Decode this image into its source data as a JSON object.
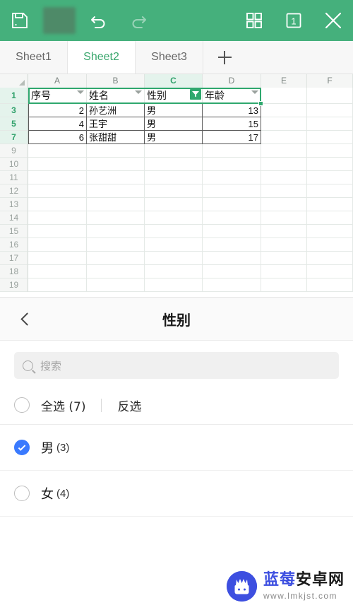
{
  "toolbar": {
    "save_label": "save-icon",
    "redacted_label": "",
    "undo_label": "undo-icon",
    "redo_label": "redo-icon",
    "grid_label": "grid-icon",
    "sheet_count_label": "1",
    "close_label": "close-icon",
    "bg_color": "#45b07c"
  },
  "sheets": {
    "tabs": [
      {
        "label": "Sheet1",
        "active": false
      },
      {
        "label": "Sheet2",
        "active": true
      },
      {
        "label": "Sheet3",
        "active": false
      }
    ],
    "add_label": "+"
  },
  "grid": {
    "columns": [
      "A",
      "B",
      "C",
      "D",
      "E",
      "F"
    ],
    "selected_column": "C",
    "header_row": {
      "row_number": "1",
      "cells": [
        "序号",
        "姓名",
        "性别",
        "年龄"
      ],
      "active_filter_column": "性别"
    },
    "rows": [
      {
        "row_number": "3",
        "cells": [
          "2",
          "孙艺洲",
          "男",
          "13"
        ]
      },
      {
        "row_number": "5",
        "cells": [
          "4",
          "王宇",
          "男",
          "15"
        ]
      },
      {
        "row_number": "7",
        "cells": [
          "6",
          "张甜甜",
          "男",
          "17"
        ]
      }
    ],
    "empty_row_numbers": [
      "9",
      "10",
      "11",
      "12",
      "13",
      "14",
      "15",
      "16",
      "17",
      "18",
      "19"
    ],
    "accent_color": "#2fa86e"
  },
  "filter_panel": {
    "back_label": "back-icon",
    "title": "性别",
    "search_placeholder": "搜索",
    "select_all_label": "全选 (7)",
    "invert_label": "反选",
    "select_all_checked": false,
    "options": [
      {
        "label": "男",
        "count": "(3)",
        "checked": true
      },
      {
        "label": "女",
        "count": "(4)",
        "checked": false
      }
    ],
    "checked_color": "#3a7afe"
  },
  "watermark": {
    "brand_blue": "蓝莓",
    "brand_dark": "安卓网",
    "url": "www.lmkjst.com"
  }
}
